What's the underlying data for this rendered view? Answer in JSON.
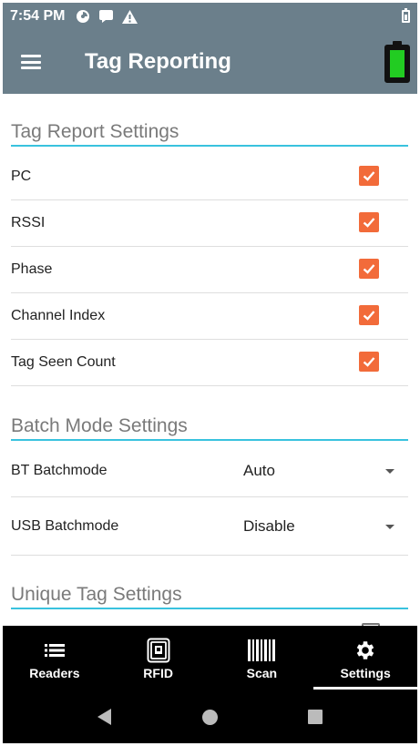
{
  "status_bar": {
    "time": "7:54 PM",
    "icons": [
      "sync-icon",
      "message-icon",
      "warning-icon",
      "battery-icon"
    ]
  },
  "app_bar": {
    "title": "Tag Reporting",
    "menu_icon": "hamburger-menu-icon",
    "reader_battery_icon": "reader-battery-icon",
    "reader_battery_color": "#22cc22"
  },
  "tag_report": {
    "header": "Tag Report Settings",
    "items": [
      {
        "label": "PC",
        "checked": true
      },
      {
        "label": "RSSI",
        "checked": true
      },
      {
        "label": "Phase",
        "checked": true
      },
      {
        "label": "Channel Index",
        "checked": true
      },
      {
        "label": "Tag Seen Count",
        "checked": true
      }
    ]
  },
  "batch_mode": {
    "header": "Batch Mode Settings",
    "items": [
      {
        "label": "BT Batchmode",
        "value": "Auto"
      },
      {
        "label": "USB Batchmode",
        "value": "Disable"
      }
    ]
  },
  "unique_tag": {
    "header": "Unique Tag Settings"
  },
  "bottom_nav": {
    "items": [
      {
        "label": "Readers",
        "icon": "list-icon",
        "active": false
      },
      {
        "label": "RFID",
        "icon": "rfid-tag-icon",
        "active": false
      },
      {
        "label": "Scan",
        "icon": "barcode-icon",
        "active": false
      },
      {
        "label": "Settings",
        "icon": "gear-icon",
        "active": true
      }
    ]
  },
  "system_nav": {
    "icons": [
      "back-icon",
      "home-icon",
      "recents-icon"
    ]
  },
  "colors": {
    "app_bar": "#6b7f8b",
    "accent_checkbox": "#f26b3a",
    "section_underline": "#39c2de"
  }
}
